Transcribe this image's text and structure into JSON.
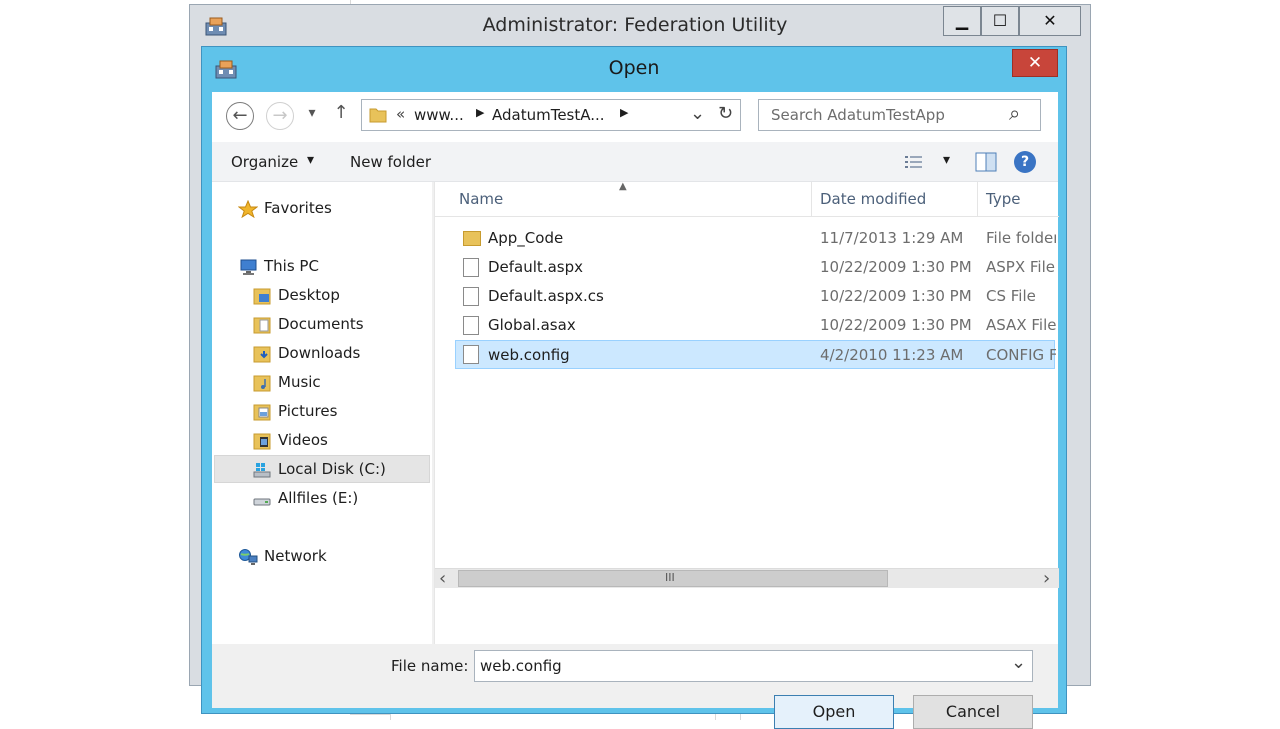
{
  "outer_window": {
    "title": "Administrator: Federation Utility",
    "minimize": "▁",
    "maximize": "☐",
    "close": "✕"
  },
  "dialog": {
    "title": "Open",
    "close": "✕"
  },
  "address_bar": {
    "back": "←",
    "forward": "→",
    "recent": "▾",
    "up": "↑",
    "overflow": "«",
    "crumbs": [
      "www...",
      "AdatumTestA..."
    ],
    "dropdown": "⌄",
    "refresh": "↻",
    "search_placeholder": "Search AdatumTestApp",
    "search_icon": "⌕"
  },
  "toolbar": {
    "organize": "Organize",
    "organize_arrow": "▾",
    "new_folder": "New folder",
    "view_arrow": "▾",
    "help": "?"
  },
  "nav_pane": {
    "favorites": "Favorites",
    "this_pc": "This PC",
    "items": [
      "Desktop",
      "Documents",
      "Downloads",
      "Music",
      "Pictures",
      "Videos",
      "Local Disk (C:)",
      "Allfiles (E:)"
    ],
    "network": "Network"
  },
  "columns": {
    "name": "Name",
    "date": "Date modified",
    "type": "Type"
  },
  "files": [
    {
      "name": "App_Code",
      "date": "11/7/2013 1:29 AM",
      "type": "File folder",
      "kind": "folder"
    },
    {
      "name": "Default.aspx",
      "date": "10/22/2009 1:30 PM",
      "type": "ASPX File",
      "kind": "file"
    },
    {
      "name": "Default.aspx.cs",
      "date": "10/22/2009 1:30 PM",
      "type": "CS File",
      "kind": "file"
    },
    {
      "name": "Global.asax",
      "date": "10/22/2009 1:30 PM",
      "type": "ASAX File",
      "kind": "file"
    },
    {
      "name": "web.config",
      "date": "4/2/2010 11:23 AM",
      "type": "CONFIG File",
      "kind": "file"
    }
  ],
  "scroll": {
    "left": "‹",
    "right": "›",
    "grip": "III"
  },
  "bottom": {
    "file_name_label": "File name:",
    "file_name_value": "web.config",
    "dropdown": "⌄",
    "open": "Open",
    "cancel": "Cancel"
  }
}
